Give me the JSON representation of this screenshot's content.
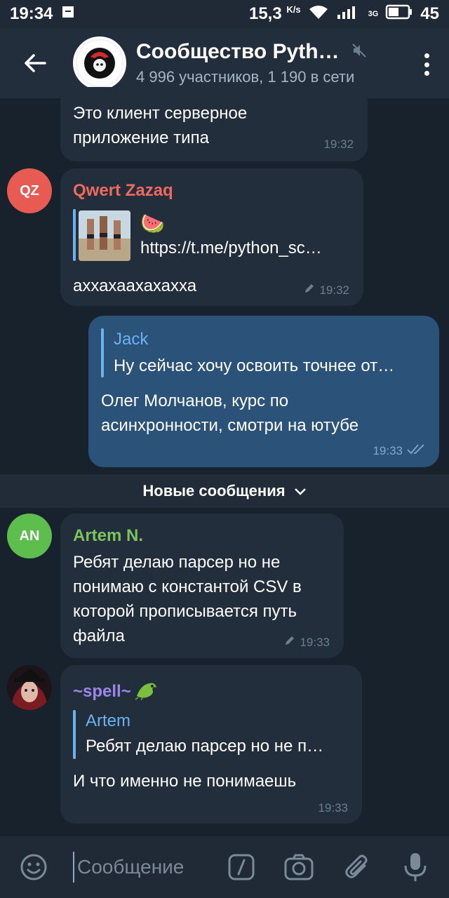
{
  "status_bar": {
    "time": "19:34",
    "speed": "15,3",
    "speed_unit": "K/s",
    "network": "3G",
    "battery": "45"
  },
  "header": {
    "title": "Сообщество Pyth…",
    "subtitle": "4 996 участников, 1 190 в сети"
  },
  "messages": [
    {
      "text": "Это клиент серверное приложение типа",
      "line1": "Это клиент серверное",
      "line2": "приложение типа",
      "time": "19:32"
    },
    {
      "avatar_initials": "QZ",
      "avatar_color": "#e85b53",
      "sender": "Qwert Zazaq",
      "sender_color": "#ef6a5c",
      "link_emoji": "🍉",
      "link_url": "https://t.me/python_sc…",
      "text": "аххахаахахахха",
      "time": "19:32"
    },
    {
      "reply_name": "Jack",
      "reply_text": "Ну сейчас хочу освоить точнее от…",
      "line1": "Олег Молчанов, курс по",
      "line2": "асинхронности, смотри на ютубе",
      "time": "19:33"
    },
    {
      "avatar_initials": "AN",
      "avatar_color": "#5dbd4d",
      "sender": "Artem N.",
      "sender_color": "#7cc55c",
      "lines": [
        "Ребят делаю парсер но не",
        "понимаю с константой CSV в",
        "которой прописывается путь",
        "файла"
      ],
      "time": "19:33"
    },
    {
      "sender": "~spell~",
      "sender_color": "#9c87e8",
      "reply_name": "Artem",
      "reply_text": "Ребят делаю парсер но не п…",
      "text": "И что именно не понимаешь",
      "time": "19:33"
    }
  ],
  "divider": {
    "label": "Новые сообщения"
  },
  "input": {
    "placeholder": "Сообщение"
  },
  "colors": {
    "background": "#18222d",
    "bubble_in": "#222e3b",
    "bubble_out": "#2b5278",
    "header": "#232e3c",
    "reply_accent": "#6ab3f3"
  }
}
